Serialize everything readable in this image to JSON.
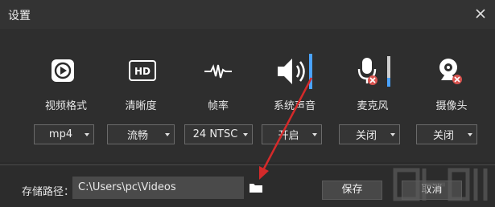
{
  "window": {
    "title": "设置"
  },
  "settings": [
    {
      "label": "视频格式",
      "value": "mp4",
      "icon": "video-format-icon"
    },
    {
      "label": "清晰度",
      "value": "流畅",
      "icon": "hd-icon"
    },
    {
      "label": "帧率",
      "value": "24 NTSC",
      "icon": "frame-rate-icon"
    },
    {
      "label": "系统声音",
      "value": "开启",
      "icon": "speaker-icon"
    },
    {
      "label": "麦克风",
      "value": "关闭",
      "icon": "microphone-icon"
    },
    {
      "label": "摄像头",
      "value": "关闭",
      "icon": "camera-icon"
    }
  ],
  "hd_icon_text": "HD",
  "volume_levels": {
    "system_sound": 1.0,
    "microphone": 0.3
  },
  "storage": {
    "label": "存储路径：",
    "path": "C:\\Users\\pc\\Videos"
  },
  "buttons": {
    "save": "保存",
    "cancel": "取消"
  },
  "colors": {
    "background": "#2b2b2b",
    "accent": "#4aa3ff",
    "annotation": "#d42a2a",
    "disabled_badge": "#d9534f"
  }
}
